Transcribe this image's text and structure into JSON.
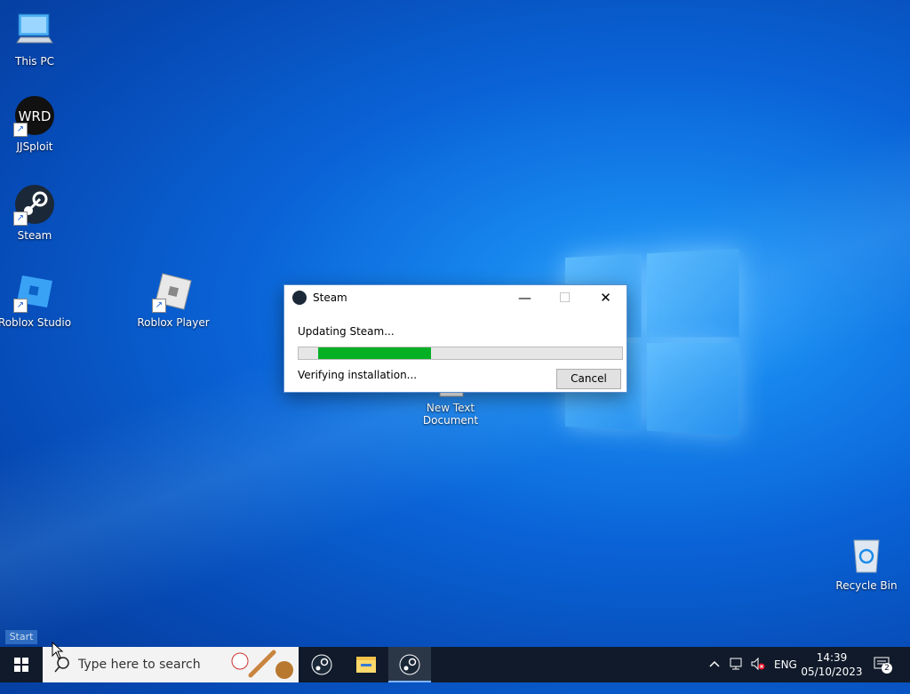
{
  "desktop": {
    "icons": [
      {
        "label": "This PC"
      },
      {
        "label": "JJSploit"
      },
      {
        "label": "Steam"
      },
      {
        "label": "Roblox Studio"
      },
      {
        "label": "Roblox Player"
      },
      {
        "label": "New Text Document"
      },
      {
        "label": "Recycle Bin"
      }
    ],
    "jjsploit_logo_text": "WRD",
    "start_label": "Start"
  },
  "dialog": {
    "title": "Steam",
    "status": "Updating Steam...",
    "detail": "Verifying installation...",
    "progress_start": 0.06,
    "progress_end": 0.41,
    "cancel_label": "Cancel",
    "minimize": "—",
    "maximize": "☐",
    "close": "✕"
  },
  "taskbar": {
    "search_placeholder": "Type here to search",
    "language": "ENG",
    "time": "14:39",
    "date": "05/10/2023",
    "notifications_count": "2"
  }
}
